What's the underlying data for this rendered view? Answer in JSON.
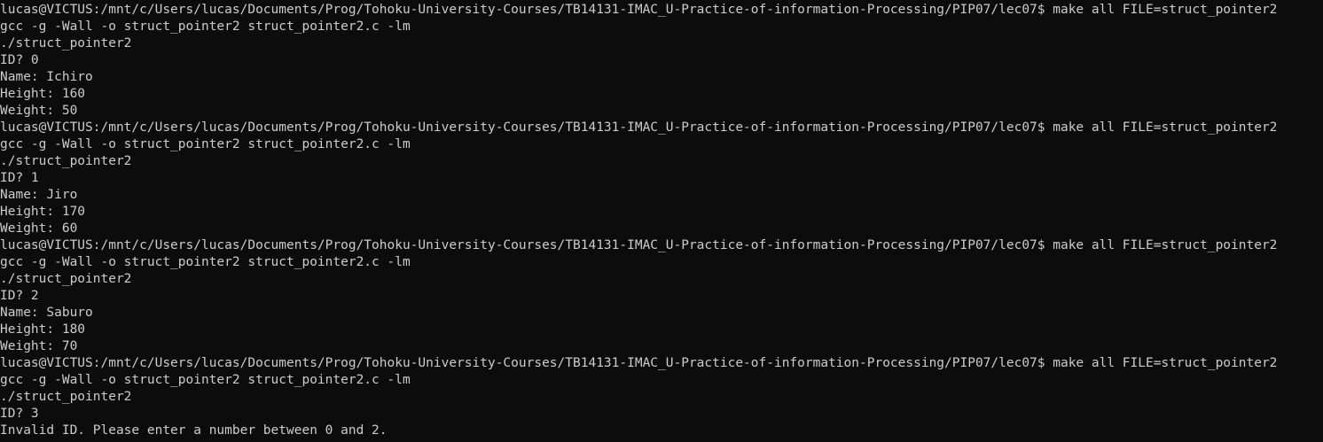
{
  "terminal": {
    "lines": [
      "lucas@VICTUS:/mnt/c/Users/lucas/Documents/Prog/Tohoku-University-Courses/TB14131-IMAC_U-Practice-of-information-Processing/PIP07/lec07$ make all FILE=struct_pointer2",
      "gcc -g -Wall -o struct_pointer2 struct_pointer2.c -lm",
      "./struct_pointer2",
      "ID? 0",
      "Name: Ichiro",
      "Height: 160",
      "Weight: 50",
      "lucas@VICTUS:/mnt/c/Users/lucas/Documents/Prog/Tohoku-University-Courses/TB14131-IMAC_U-Practice-of-information-Processing/PIP07/lec07$ make all FILE=struct_pointer2",
      "gcc -g -Wall -o struct_pointer2 struct_pointer2.c -lm",
      "./struct_pointer2",
      "ID? 1",
      "Name: Jiro",
      "Height: 170",
      "Weight: 60",
      "lucas@VICTUS:/mnt/c/Users/lucas/Documents/Prog/Tohoku-University-Courses/TB14131-IMAC_U-Practice-of-information-Processing/PIP07/lec07$ make all FILE=struct_pointer2",
      "gcc -g -Wall -o struct_pointer2 struct_pointer2.c -lm",
      "./struct_pointer2",
      "ID? 2",
      "Name: Saburo",
      "Height: 180",
      "Weight: 70",
      "lucas@VICTUS:/mnt/c/Users/lucas/Documents/Prog/Tohoku-University-Courses/TB14131-IMAC_U-Practice-of-information-Processing/PIP07/lec07$ make all FILE=struct_pointer2",
      "gcc -g -Wall -o struct_pointer2 struct_pointer2.c -lm",
      "./struct_pointer2",
      "ID? 3",
      "Invalid ID. Please enter a number between 0 and 2."
    ],
    "colors": {
      "background": "#0c0c0c",
      "foreground": "#cccccc"
    }
  }
}
